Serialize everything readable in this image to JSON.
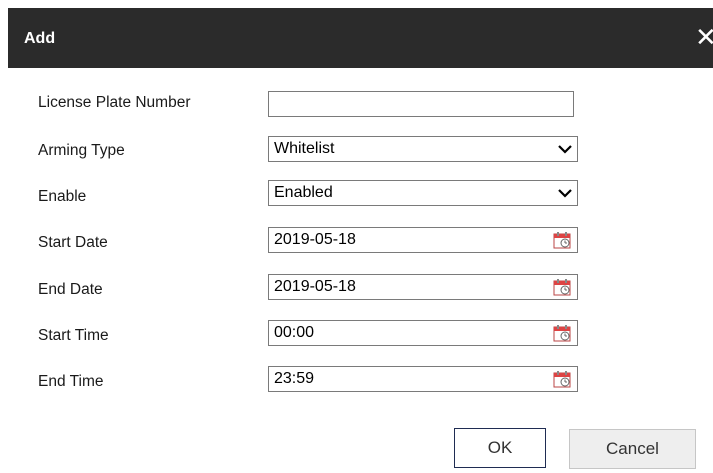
{
  "dialog": {
    "title": "Add",
    "close_icon": "close-icon"
  },
  "form": {
    "license_plate": {
      "label": "License Plate Number",
      "value": ""
    },
    "arming_type": {
      "label": "Arming Type",
      "value": "Whitelist"
    },
    "enable": {
      "label": "Enable",
      "value": "Enabled"
    },
    "start_date": {
      "label": "Start Date",
      "value": "2019-05-18"
    },
    "end_date": {
      "label": "End Date",
      "value": "2019-05-18"
    },
    "start_time": {
      "label": "Start Time",
      "value": "00:00"
    },
    "end_time": {
      "label": "End Time",
      "value": "23:59"
    }
  },
  "buttons": {
    "ok": "OK",
    "cancel": "Cancel"
  },
  "colors": {
    "titlebar": "#2b2b2b",
    "ok_border": "#1f2c52",
    "cancel_bg": "#eeeeee"
  }
}
